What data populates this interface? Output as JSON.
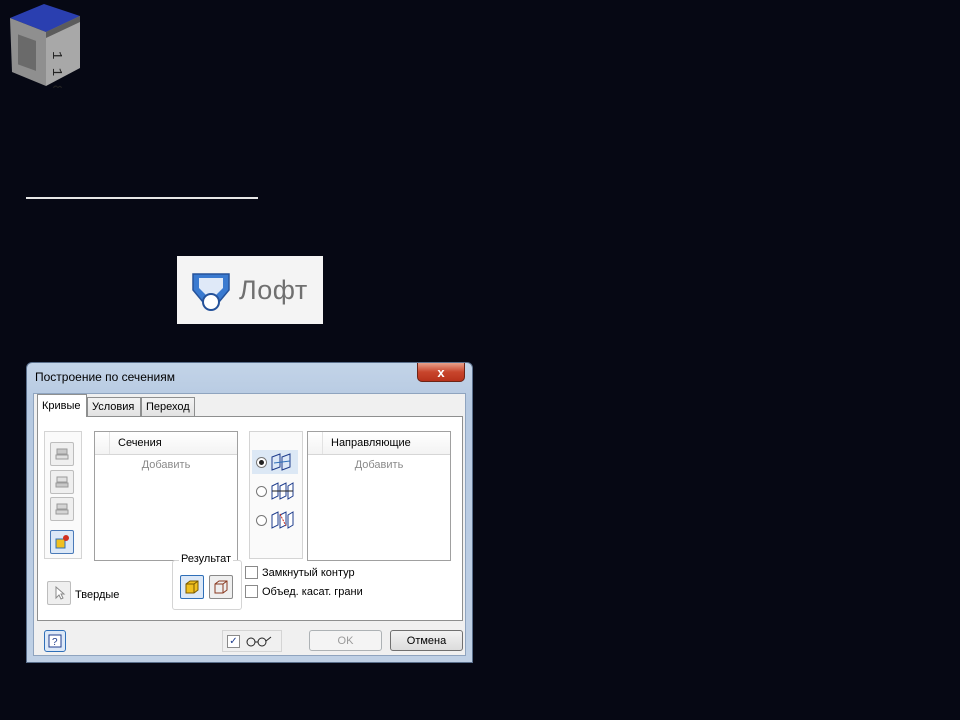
{
  "dialog": {
    "title": "Построение по сечениям",
    "close_label": "x",
    "tabs": [
      {
        "label": "Кривые",
        "active": true
      },
      {
        "label": "Условия",
        "active": false
      },
      {
        "label": "Переход",
        "active": false
      }
    ],
    "sections": {
      "header": "Сечения",
      "add_label": "Добавить"
    },
    "guides": {
      "header": "Направляющие",
      "add_label": "Добавить"
    },
    "mode_options": [
      {
        "icon": "loft-rails-icon",
        "selected": true
      },
      {
        "icon": "loft-centerline-icon",
        "selected": false
      },
      {
        "icon": "loft-area-icon",
        "selected": false
      }
    ],
    "solid_label": "Твердые",
    "result": {
      "label": "Результат",
      "options": [
        "solid-result-icon",
        "surface-result-icon"
      ]
    },
    "closed_loop_label": "Замкнутый контур",
    "merge_tangent_label": "Объед. касат. грани",
    "preview_checked": true,
    "ok_label": "OK",
    "cancel_label": "Отмена"
  },
  "ribbon": {
    "loft_label": "Лофт"
  },
  "colors": {
    "background": "#060814",
    "accent_blue": "#2f6fb8",
    "result_yellow": "#f0c020"
  }
}
